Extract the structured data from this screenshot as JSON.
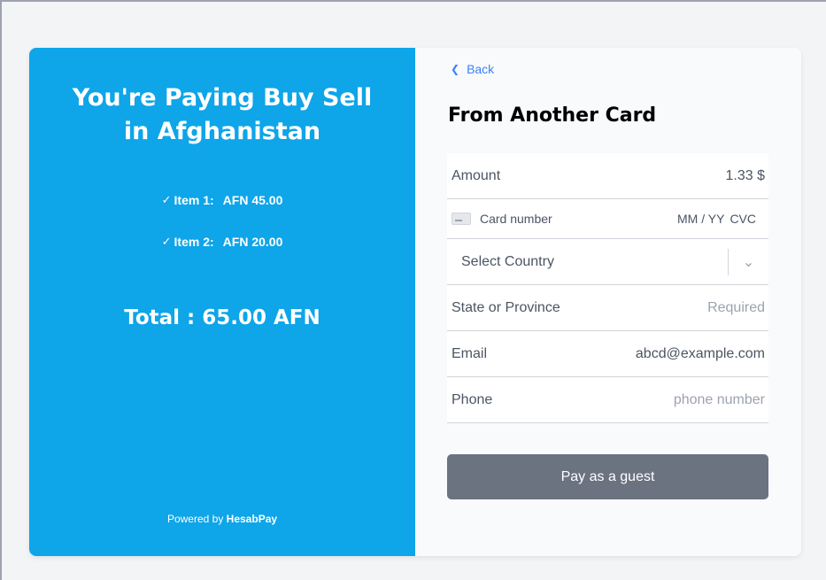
{
  "summary": {
    "title": "You're Paying Buy Sell in Afghanistan",
    "items": [
      {
        "label": "Item 1:",
        "amount": "AFN 45.00"
      },
      {
        "label": "Item 2:",
        "amount": "AFN 20.00"
      }
    ],
    "total": "Total : 65.00 AFN",
    "powered_prefix": "Powered by",
    "powered_brand": "HesabPay"
  },
  "form": {
    "back_label": "Back",
    "heading": "From Another Card",
    "amount_label": "Amount",
    "amount_value": "1.33 $",
    "card_number_placeholder": "Card number",
    "expiry_placeholder": "MM / YY",
    "cvc_placeholder": "CVC",
    "country_placeholder": "Select Country",
    "state_label": "State or Province",
    "state_placeholder": "Required",
    "email_label": "Email",
    "email_value": "abcd@example.com",
    "phone_label": "Phone",
    "phone_placeholder": "phone number",
    "pay_label": "Pay as a guest"
  },
  "colors": {
    "summary_bg": "#0ea5e9",
    "link": "#3b82f6",
    "pay_button": "#6b7280"
  },
  "icons": {
    "back": "chevron-left-icon",
    "check": "check-icon",
    "card": "credit-card-icon",
    "select": "chevron-down-icon"
  }
}
